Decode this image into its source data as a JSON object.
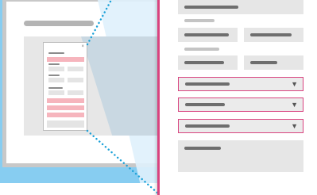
{
  "mini_panel": {
    "close_glyph": "×"
  },
  "panel": {
    "selects": [
      {
        "caret": "▼"
      },
      {
        "caret": "▼"
      },
      {
        "caret": "▼"
      }
    ]
  },
  "colors": {
    "accent": "#d9437f",
    "screen_blue": "#87cdf1",
    "field_gray": "#e6e6e6",
    "error_pink": "#f6b5bd",
    "connector_dots": "#1ba1d8"
  }
}
